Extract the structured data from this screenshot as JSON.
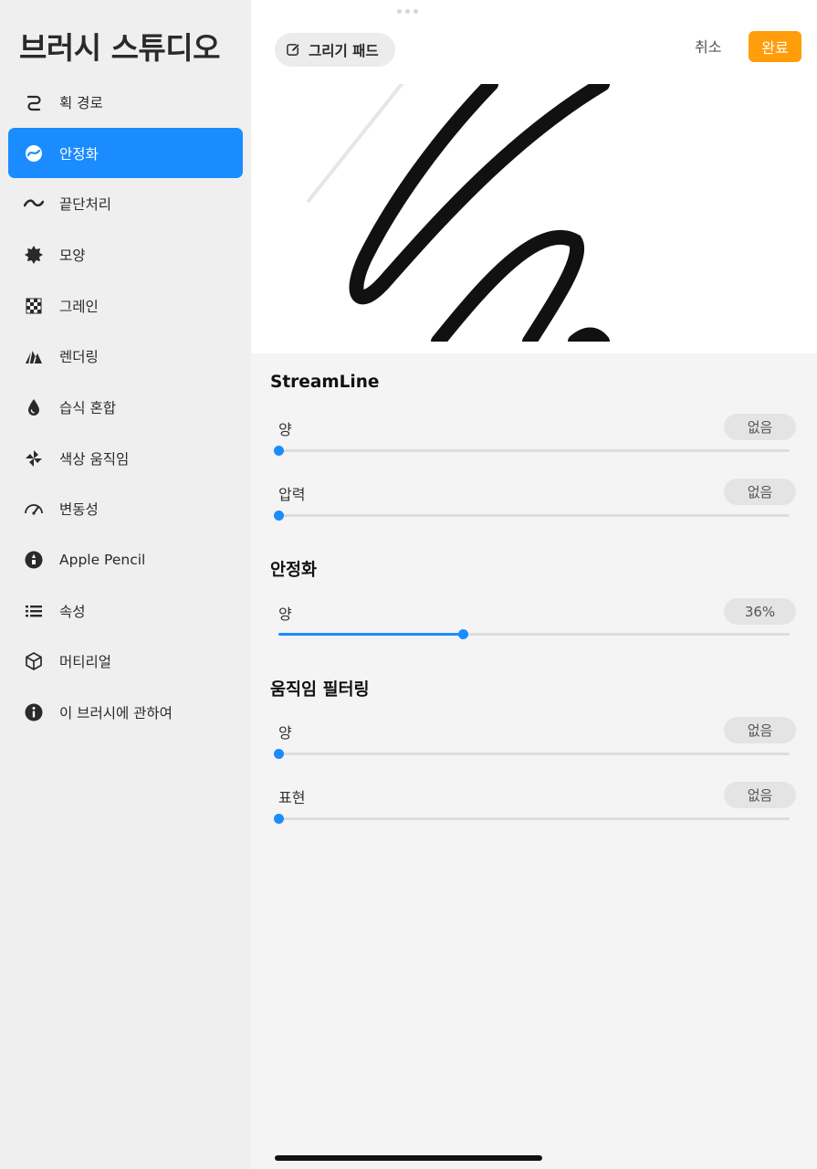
{
  "sidebar": {
    "title": "브러시 스튜디오",
    "items": [
      {
        "label": "획 경로",
        "icon": "stroke-path-icon",
        "active": false
      },
      {
        "label": "안정화",
        "icon": "stabilization-icon",
        "active": true
      },
      {
        "label": "끝단처리",
        "icon": "taper-icon",
        "active": false
      },
      {
        "label": "모양",
        "icon": "shape-icon",
        "active": false
      },
      {
        "label": "그레인",
        "icon": "grain-icon",
        "active": false
      },
      {
        "label": "렌더링",
        "icon": "rendering-icon",
        "active": false
      },
      {
        "label": "습식 혼합",
        "icon": "wet-mix-icon",
        "active": false
      },
      {
        "label": "색상 움직임",
        "icon": "color-dynamics-icon",
        "active": false
      },
      {
        "label": "변동성",
        "icon": "dynamics-icon",
        "active": false
      },
      {
        "label": "Apple Pencil",
        "icon": "apple-pencil-icon",
        "active": false
      },
      {
        "label": "속성",
        "icon": "properties-icon",
        "active": false
      },
      {
        "label": "머티리얼",
        "icon": "materials-icon",
        "active": false
      },
      {
        "label": "이 브러시에 관하여",
        "icon": "info-icon",
        "active": false
      }
    ]
  },
  "header": {
    "pad_label": "그리기 패드",
    "cancel_label": "취소",
    "done_label": "완료"
  },
  "colors": {
    "accent": "#1a8cff",
    "done": "#ff9d0a"
  },
  "sections": {
    "streamline": {
      "title": "StreamLine",
      "rows": [
        {
          "label": "양",
          "value": "없음",
          "level": 0
        },
        {
          "label": "압력",
          "value": "없음",
          "level": 0
        }
      ]
    },
    "stabilization": {
      "title": "안정화",
      "rows": [
        {
          "label": "양",
          "value": "36%",
          "level": 0.36
        }
      ]
    },
    "motion_filtering": {
      "title": "움직임 필터링",
      "rows": [
        {
          "label": "양",
          "value": "없음",
          "level": 0
        },
        {
          "label": "표현",
          "value": "없음",
          "level": 0
        }
      ]
    }
  }
}
